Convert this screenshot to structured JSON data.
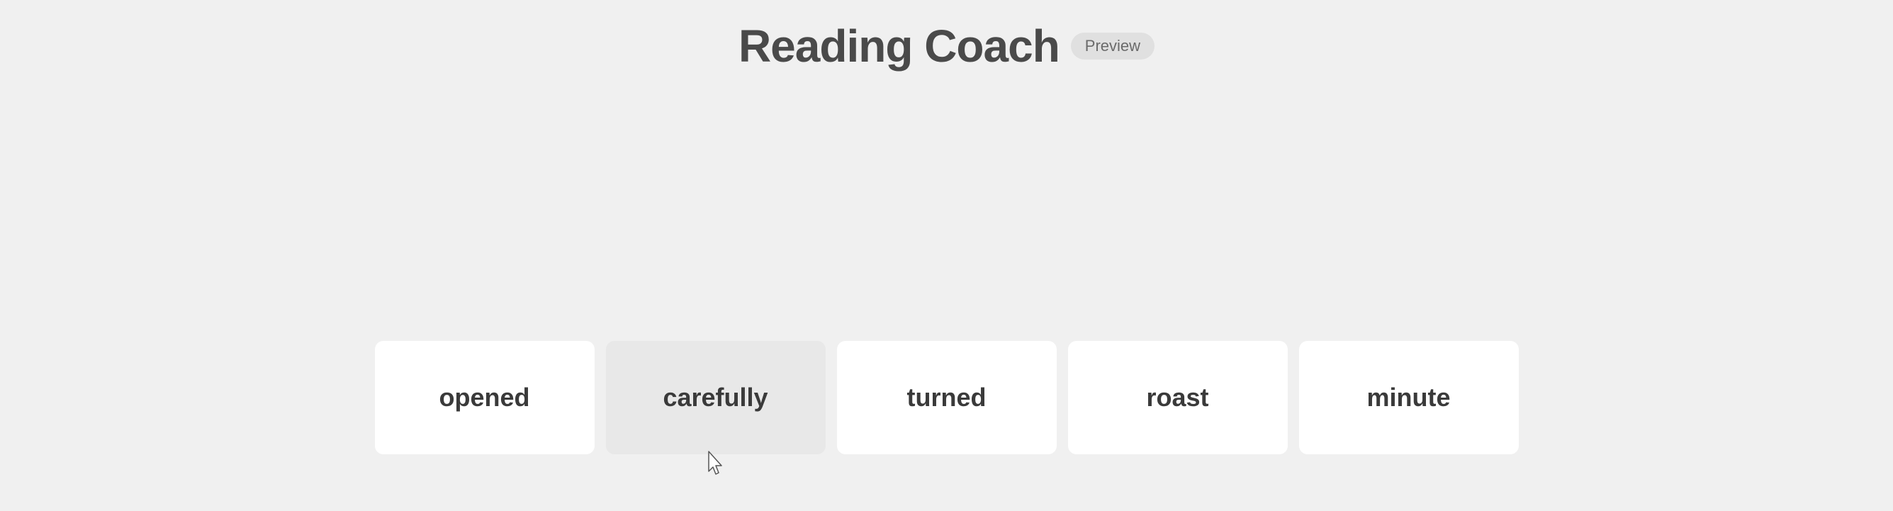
{
  "header": {
    "title": "Reading Coach",
    "badge": "Preview"
  },
  "cards": [
    {
      "id": "opened",
      "word": "opened",
      "active": false
    },
    {
      "id": "carefully",
      "word": "carefully",
      "active": true
    },
    {
      "id": "turned",
      "word": "turned",
      "active": false
    },
    {
      "id": "roast",
      "word": "roast",
      "active": false
    },
    {
      "id": "minute",
      "word": "minute",
      "active": false
    }
  ],
  "colors": {
    "background": "#f0f0f0",
    "card_default": "#ffffff",
    "card_active": "#e8e8e8",
    "star_color": "#c8c8c8",
    "title_color": "#4a4a4a",
    "badge_bg": "#e0e0e0",
    "badge_text": "#6a6a6a"
  }
}
